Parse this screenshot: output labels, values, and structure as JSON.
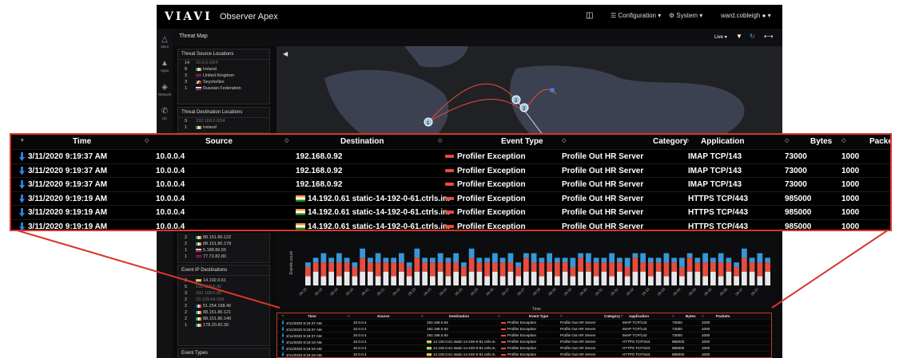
{
  "app": {
    "logo": "VIAVI",
    "title": "Observer Apex"
  },
  "topbar": {
    "configuration": "Configuration",
    "system": "System",
    "user": "ward.cobleigh"
  },
  "sidenav": [
    {
      "label": "Sites",
      "icon": "sites-icon"
    },
    {
      "label": "Apps",
      "icon": "apps-icon"
    },
    {
      "label": "Network",
      "icon": "network-icon"
    },
    {
      "label": "UC",
      "icon": "phone-icon"
    }
  ],
  "subbar": {
    "page": "Threat Map",
    "mode": "Live"
  },
  "source_panel": {
    "title": "Threat Source Locations",
    "rows": [
      {
        "count": "14",
        "label": "10.0.0.0/24",
        "flag": ""
      },
      {
        "count": "8",
        "label": "Ireland",
        "flag": "ie"
      },
      {
        "count": "3",
        "label": "United Kingdom",
        "flag": "uk"
      },
      {
        "count": "3",
        "label": "Seychelles",
        "flag": "sc"
      },
      {
        "count": "1",
        "label": "Russian Federation",
        "flag": "ru"
      }
    ]
  },
  "dest_panel": {
    "title": "Threat Destination Locations",
    "rows": [
      {
        "count": "9",
        "label": "192.168.0.0/24",
        "flag": ""
      },
      {
        "count": "1",
        "label": "Ireland",
        "flag": "ie"
      }
    ]
  },
  "mid_panel": {
    "rows": [
      {
        "count": "2",
        "label": "88.151.80.122",
        "flag": "ie"
      },
      {
        "count": "2",
        "label": "88.151.80.178",
        "flag": "ie"
      },
      {
        "count": "1",
        "label": "5.188.86.55",
        "flag": "ru"
      },
      {
        "count": "1",
        "label": "77.72.82.80",
        "flag": "uk"
      }
    ]
  },
  "event_dest_panel": {
    "title": "Event IP Destinations",
    "rows": [
      {
        "count": "3",
        "label": "14.192.0.61",
        "flag": "in"
      },
      {
        "count": "5",
        "label": "192.168.0.42",
        "flag": ""
      },
      {
        "count": "3",
        "label": "192.168.0.92",
        "flag": ""
      },
      {
        "count": "2",
        "label": "23.129.64.159",
        "flag": ""
      },
      {
        "count": "2",
        "label": "51.254.198.46",
        "flag": "fr"
      },
      {
        "count": "2",
        "label": "88.151.80.121",
        "flag": "ie"
      },
      {
        "count": "2",
        "label": "88.151.80.146",
        "flag": "ie"
      },
      {
        "count": "1",
        "label": "178.20.82.30",
        "flag": "ie"
      }
    ]
  },
  "event_types_panel": {
    "title": "Event Types"
  },
  "map": {
    "markers": [
      "1",
      "2",
      "2"
    ]
  },
  "chart_data": {
    "type": "bar",
    "stacked": true,
    "ylabel": "Events count",
    "xlabel": "Time",
    "categories": [
      "09:18",
      "09:18",
      "09:19",
      "09:19",
      "09:19",
      "09:20",
      "09:20",
      "09:20",
      "09:21",
      "09:21",
      "09:21",
      "09:22",
      "09:22",
      "09:22",
      "09:23",
      "09:23",
      "09:23",
      "09:24",
      "09:24",
      "09:24",
      "09:25",
      "09:25",
      "09:25",
      "09:26",
      "09:26",
      "09:26",
      "09:27",
      "09:27",
      "09:27",
      "09:28",
      "09:28",
      "09:28",
      "09:29",
      "09:29",
      "09:29",
      "09:30",
      "09:30",
      "09:30",
      "09:31",
      "09:31",
      "09:31",
      "09:32",
      "09:32",
      "09:32",
      "09:33",
      "09:33",
      "09:33",
      "09:34",
      "09:34",
      "09:34",
      "09:35",
      "09:35",
      "09:35",
      "09:36",
      "09:36",
      "09:36",
      "09:37",
      "09:37",
      "09:37",
      "09:38"
    ],
    "series": [
      {
        "color": "#e8e8e8",
        "values": [
          2,
          3,
          2,
          3,
          2,
          3,
          2,
          3,
          3,
          2,
          3,
          2,
          3,
          2,
          3,
          3,
          2,
          3,
          2,
          3,
          2,
          3,
          3,
          2,
          3,
          2,
          3,
          2,
          3,
          3,
          2,
          3,
          2,
          3,
          2,
          3,
          3,
          2,
          3,
          2,
          3,
          2,
          3,
          3,
          2,
          3,
          2,
          3,
          2,
          3,
          3,
          2,
          3,
          2,
          3,
          2,
          3,
          3,
          2,
          3
        ]
      },
      {
        "color": "#e74c3c",
        "values": [
          2,
          2,
          3,
          2,
          3,
          2,
          2,
          3,
          2,
          3,
          2,
          3,
          2,
          2,
          3,
          2,
          3,
          2,
          3,
          2,
          2,
          3,
          2,
          3,
          2,
          3,
          2,
          2,
          3,
          2,
          3,
          2,
          3,
          2,
          2,
          3,
          2,
          3,
          2,
          3,
          2,
          2,
          3,
          2,
          3,
          2,
          3,
          2,
          2,
          3,
          2,
          3,
          2,
          3,
          2,
          2,
          3,
          2,
          3,
          2
        ]
      },
      {
        "color": "#3498db",
        "values": [
          1,
          1,
          2,
          1,
          2,
          1,
          1,
          2,
          1,
          2,
          1,
          1,
          2,
          1,
          2,
          1,
          1,
          2,
          1,
          2,
          1,
          2,
          1,
          1,
          2,
          1,
          2,
          1,
          1,
          2,
          1,
          2,
          1,
          1,
          2,
          1,
          2,
          1,
          1,
          2,
          1,
          2,
          1,
          2,
          1,
          1,
          2,
          1,
          2,
          1,
          1,
          2,
          1,
          2,
          1,
          1,
          2,
          1,
          2,
          1
        ]
      }
    ]
  },
  "table": {
    "headers": [
      "Time",
      "Source",
      "Destination",
      "Event Type",
      "Category",
      "Application",
      "Bytes",
      "Packets"
    ],
    "rows": [
      {
        "time": "3/11/2020 9:19:37 AM",
        "source": "10.0.0.4",
        "dest": "192.168.0.92",
        "flag": false,
        "event": "Profiler Exception",
        "category": "Profile Out HR Server",
        "app": "IMAP TCP/143",
        "bytes": "73000",
        "packets": "1000"
      },
      {
        "time": "3/11/2020 9:19:37 AM",
        "source": "10.0.0.4",
        "dest": "192.168.0.92",
        "flag": false,
        "event": "Profiler Exception",
        "category": "Profile Out HR Server",
        "app": "IMAP TCP/143",
        "bytes": "73000",
        "packets": "1000"
      },
      {
        "time": "3/11/2020 9:19:37 AM",
        "source": "10.0.0.4",
        "dest": "192.168.0.92",
        "flag": false,
        "event": "Profiler Exception",
        "category": "Profile Out HR Server",
        "app": "IMAP TCP/143",
        "bytes": "73000",
        "packets": "1000"
      },
      {
        "time": "3/11/2020 9:19:19 AM",
        "source": "10.0.0.4",
        "dest": "14.192.0.61 static-14-192-0-61.ctrls.in.",
        "flag": true,
        "event": "Profiler Exception",
        "category": "Profile Out HR Server",
        "app": "HTTPS TCP/443",
        "bytes": "985000",
        "packets": "1000"
      },
      {
        "time": "3/11/2020 9:19:19 AM",
        "source": "10.0.0.4",
        "dest": "14.192.0.61 static-14-192-0-61.ctrls.in.",
        "flag": true,
        "event": "Profiler Exception",
        "category": "Profile Out HR Server",
        "app": "HTTPS TCP/443",
        "bytes": "985000",
        "packets": "1000"
      },
      {
        "time": "3/11/2020 9:19:19 AM",
        "source": "10.0.0.4",
        "dest": "14.192.0.61 static-14-192-0-61.ctrls.in.",
        "flag": true,
        "event": "Profiler Exception",
        "category": "Profile Out HR Server",
        "app": "HTTPS TCP/443",
        "bytes": "985000",
        "packets": "1000"
      }
    ]
  },
  "colors": {
    "accent_red": "#d9352a",
    "sort_blue": "#2e86de",
    "bg": "#0b0b0c"
  }
}
